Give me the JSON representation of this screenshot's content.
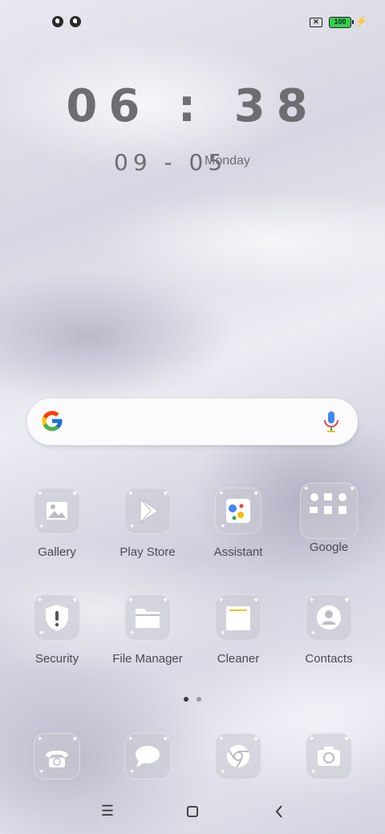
{
  "status_bar": {
    "left_icons": [
      "notification-app-icon",
      "notification-app-icon"
    ],
    "sim_label": "✕",
    "battery_level": "100",
    "charging_icon": "⚡"
  },
  "lockclock": {
    "time": "06 : 38",
    "date": "09 - 05",
    "day": "Monday"
  },
  "search_widget": {
    "logo": "google-g-icon",
    "mic": "mic-icon"
  },
  "apps": [
    {
      "label": "Gallery",
      "icon": "gallery-icon"
    },
    {
      "label": "Play Store",
      "icon": "play-store-icon"
    },
    {
      "label": "Assistant",
      "icon": "assistant-icon"
    },
    {
      "label": "Google",
      "icon": "google-folder-icon"
    },
    {
      "label": "Security",
      "icon": "security-icon"
    },
    {
      "label": "File Manager",
      "icon": "folder-icon"
    },
    {
      "label": "Cleaner",
      "icon": "cleaner-icon"
    },
    {
      "label": "Contacts",
      "icon": "contacts-icon"
    }
  ],
  "pager": {
    "pages": 2,
    "current": 1
  },
  "dock": [
    {
      "icon": "phone-icon"
    },
    {
      "icon": "messages-icon"
    },
    {
      "icon": "chrome-icon"
    },
    {
      "icon": "camera-icon"
    }
  ],
  "nav_bar": {
    "menu": "☰",
    "home": "home-icon",
    "back": "back-icon"
  },
  "colors": {
    "clock": "#6d6d72",
    "label": "#4a4a52",
    "battery_fill": "#35d14a",
    "dot_active": "#3a3a40",
    "dot_inactive": "#9a9aa4"
  }
}
